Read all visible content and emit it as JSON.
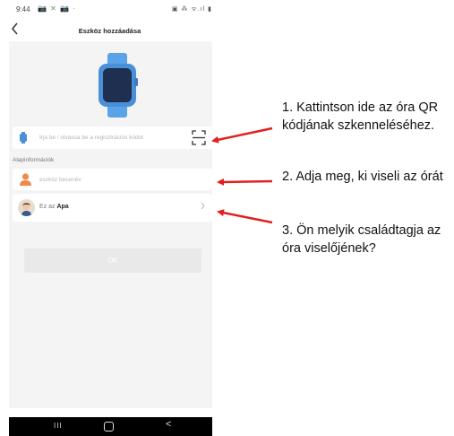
{
  "status_bar": {
    "time": "9:44",
    "left_icons": "📷 ✕ 📷 ·",
    "right_icons": "▣ ⁂ ᯤ.ıl ▮"
  },
  "header": {
    "title": "Eszköz hozzáadása",
    "back_icon": "chevron-left-icon"
  },
  "registration": {
    "placeholder": "Írja be / olvassa be a regisztrációs kódot",
    "value": "",
    "scan_icon": "qr-scan-icon"
  },
  "basic_info": {
    "section_label": "Alapinformációk",
    "nickname_placeholder": "eszköz becenév",
    "nickname_value": "",
    "relationship_prefix": "Ez az",
    "relationship_value": "Apa"
  },
  "ok_button": "OK",
  "colors": {
    "accent_blue": "#4a90d9",
    "watch_face": "#1f2f4f",
    "person_orange": "#f08a4b",
    "arrow_red": "#e02020",
    "content_bg": "#f4f4f4"
  },
  "annotations": {
    "step1": "1. Kattintson ide az óra QR kódjának szkenneléséhez.",
    "step2": "2. Adja meg, ki viseli az órát",
    "step3": "3. Ön melyik családtagja az óra viselőjének?"
  },
  "system_nav": {
    "recent": "III",
    "home": "home-icon",
    "back": "<"
  }
}
